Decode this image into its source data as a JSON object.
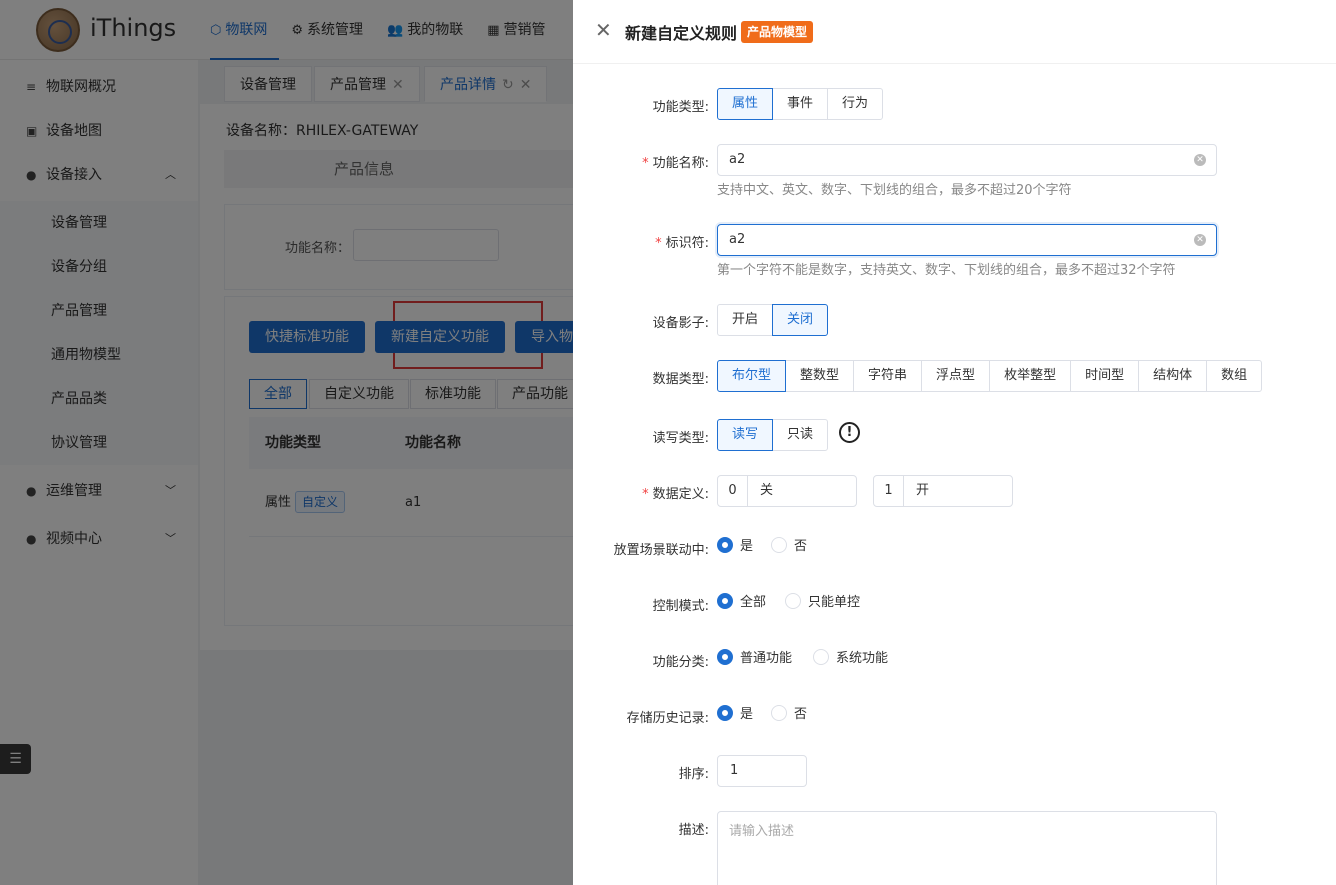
{
  "app": {
    "brand": "iThings"
  },
  "topnav": [
    {
      "label": "物联网",
      "icon": "cube-icon"
    },
    {
      "label": "系统管理",
      "icon": "gear-icon"
    },
    {
      "label": "我的物联",
      "icon": "users-icon"
    },
    {
      "label": "营销管",
      "icon": "gift-icon"
    }
  ],
  "sidebar": {
    "items": [
      {
        "label": "物联网概况"
      },
      {
        "label": "设备地图"
      },
      {
        "label": "设备接入"
      },
      {
        "label": "运维管理"
      },
      {
        "label": "视频中心"
      }
    ],
    "subitems": [
      "设备管理",
      "设备分组",
      "产品管理",
      "通用物模型",
      "产品品类",
      "协议管理"
    ]
  },
  "tabs": [
    {
      "label": "设备管理"
    },
    {
      "label": "产品管理"
    },
    {
      "label": "产品详情"
    }
  ],
  "content": {
    "device_name": "设备名称：RHILEX-GATEWAY",
    "product_info": "产品信息",
    "filter_label": "功能名称：",
    "buttons": [
      "快捷标准功能",
      "新建自定义功能",
      "导入物"
    ],
    "filter_tabs": [
      "全部",
      "自定义功能",
      "标准功能",
      "产品功能"
    ],
    "table_headers": [
      "功能类型",
      "功能名称"
    ],
    "rows": [
      {
        "type": "属性",
        "tag": "自定义",
        "name": "a1"
      }
    ]
  },
  "drawer": {
    "title": "新建自定义规则",
    "badge": "产品物模型",
    "fields": {
      "func_type": {
        "label": "功能类型:",
        "options": [
          "属性",
          "事件",
          "行为"
        ],
        "selected": 0
      },
      "func_name": {
        "label": "功能名称:",
        "value": "a2",
        "hint": "支持中文、英文、数字、下划线的组合，最多不超过20个字符"
      },
      "identifier": {
        "label": "标识符:",
        "value": "a2",
        "hint": "第一个字符不能是数字，支持英文、数字、下划线的组合，最多不超过32个字符"
      },
      "shadow": {
        "label": "设备影子:",
        "options": [
          "开启",
          "关闭"
        ],
        "selected": 1
      },
      "data_type": {
        "label": "数据类型:",
        "options": [
          "布尔型",
          "整数型",
          "字符串",
          "浮点型",
          "枚举整型",
          "时间型",
          "结构体",
          "数组"
        ],
        "selected": 0
      },
      "rw_type": {
        "label": "读写类型:",
        "options": [
          "读写",
          "只读"
        ],
        "selected": 0
      },
      "data_def": {
        "label": "数据定义:",
        "pairs": [
          {
            "key": "0",
            "value": "关"
          },
          {
            "key": "1",
            "value": "开"
          }
        ]
      },
      "scene": {
        "label": "放置场景联动中:",
        "options": [
          "是",
          "否"
        ],
        "selected": 0
      },
      "control": {
        "label": "控制模式:",
        "options": [
          "全部",
          "只能单控"
        ],
        "selected": 0
      },
      "category": {
        "label": "功能分类:",
        "options": [
          "普通功能",
          "系统功能"
        ],
        "selected": 0
      },
      "history": {
        "label": "存储历史记录:",
        "options": [
          "是",
          "否"
        ],
        "selected": 0
      },
      "order": {
        "label": "排序:",
        "value": "1"
      },
      "desc": {
        "label": "描述:",
        "placeholder": "请输入描述"
      }
    }
  },
  "colors": {
    "primary": "#1f6fd1",
    "badge": "#f06c1a",
    "required": "#f04141",
    "highlight": "#e23b3b"
  }
}
